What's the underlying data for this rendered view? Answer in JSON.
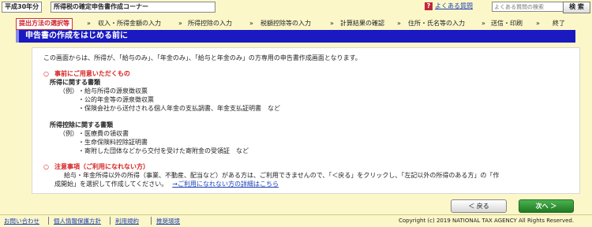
{
  "header": {
    "year_label": "平成30年分",
    "corner_title": "所得税の確定申告書作成コーナー",
    "faq_icon": "?",
    "faq_link": "よくある質問",
    "search_placeholder": "よくある質問の検索",
    "search_button": "検 索"
  },
  "steps": [
    "提出方法の選択等",
    "収入・所得金額の入力",
    "所得控除の入力",
    "税額控除等の入力",
    "計算結果の確認",
    "住所・氏名等の入力",
    "送信・印刷",
    "終了"
  ],
  "step_separator": "»",
  "page_title": "申告書の作成をはじめる前に",
  "content": {
    "intro": "この画面からは、所得が、「給与のみ」、「年金のみ」、「給与と年金のみ」の方専用の申告書作成画面となります。",
    "section1_marker": "○",
    "section1_title": "事前にご用意いただくもの",
    "income_heading": "所得に関する書類",
    "example_label": "（例）",
    "income_items": [
      "・給与所得の源泉徴収票",
      "・公的年金等の源泉徴収票",
      "・保険会社から送付される個人年金の支払調書、年金支払証明書　など"
    ],
    "deduction_heading": "所得控除に関する書類",
    "deduction_items": [
      "・医療費の領収書",
      "・生命保険料控除証明書",
      "・寄附した団体などから交付を受けた寄附金の受領証　など"
    ],
    "section2_marker": "○",
    "section2_title": "注意事項（ご利用になれない方）",
    "note_line1": "給与・年金所得以外の所得（事業、不動産、配当など）がある方は、ご利用できませんので、「＜戻る」をクリックし、「左記以外の所得のある方」の「作",
    "note_line2": "成開始」を選択して作成してください。",
    "note_link": "→ご利用になれない方の詳細はこちら"
  },
  "buttons": {
    "back": "＜ 戻る",
    "next": "次へ ＞"
  },
  "footer": {
    "links": [
      "お問い合わせ",
      "個人情報保護方針",
      "利用規約",
      "推奨環境"
    ],
    "copyright": "Copyright (c) 2019 NATIONAL TAX AGENCY All Rights Reserved."
  }
}
